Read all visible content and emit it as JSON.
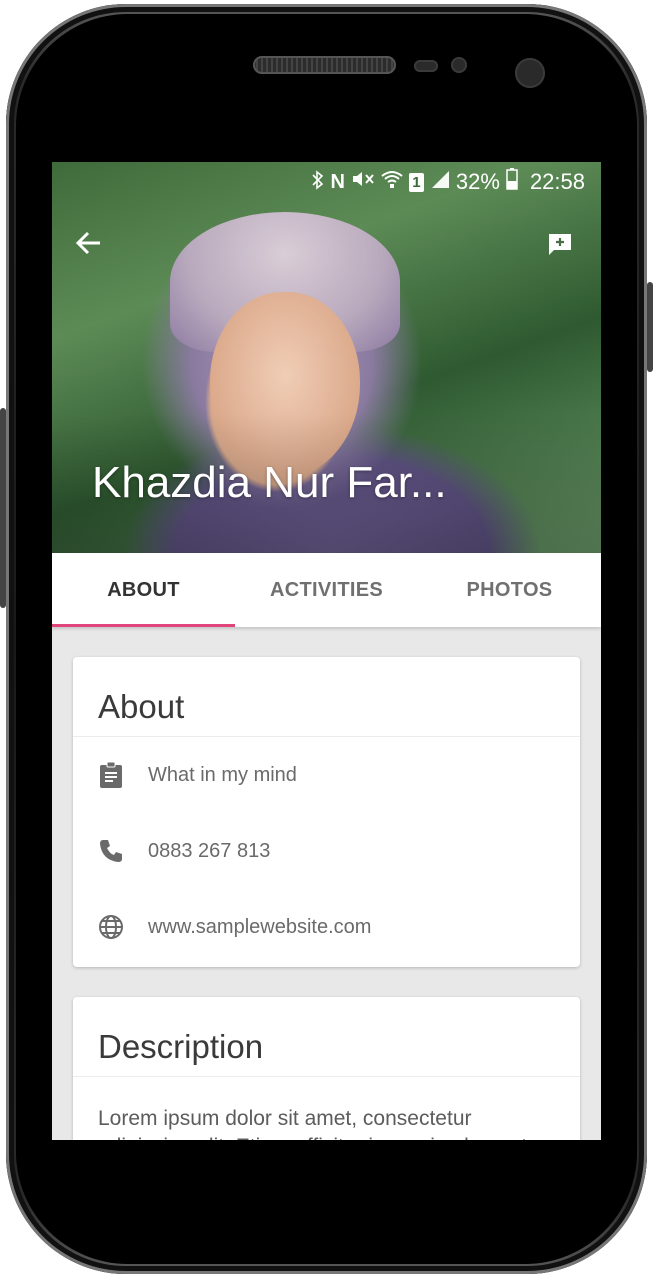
{
  "status_bar": {
    "icons": [
      "bluetooth-icon",
      "nfc-icon",
      "mute-icon",
      "wifi-icon",
      "sim-icon",
      "signal-icon",
      "battery-icon"
    ],
    "battery": "32%",
    "time": "22:58",
    "sim_label": "1",
    "nfc_label": "N"
  },
  "header": {
    "name": "Khazdia Nur Far..."
  },
  "tabs": [
    {
      "label": "ABOUT",
      "active": true
    },
    {
      "label": "ACTIVITIES",
      "active": false
    },
    {
      "label": "PHOTOS",
      "active": false
    }
  ],
  "about_card": {
    "title": "About",
    "items": [
      {
        "icon": "clipboard-icon",
        "text": "What in my mind"
      },
      {
        "icon": "phone-icon",
        "text": "0883 267 813"
      },
      {
        "icon": "globe-icon",
        "text": "www.samplewebsite.com"
      }
    ]
  },
  "description_card": {
    "title": "Description",
    "text": "Lorem ipsum dolor sit amet, consectetur adipiscing elit. Etiam efficitur ipsum in placerat"
  },
  "colors": {
    "accent": "#e0457b",
    "tab_active": "#333333",
    "tab_inactive": "#707070",
    "background": "#e8e8e8"
  }
}
